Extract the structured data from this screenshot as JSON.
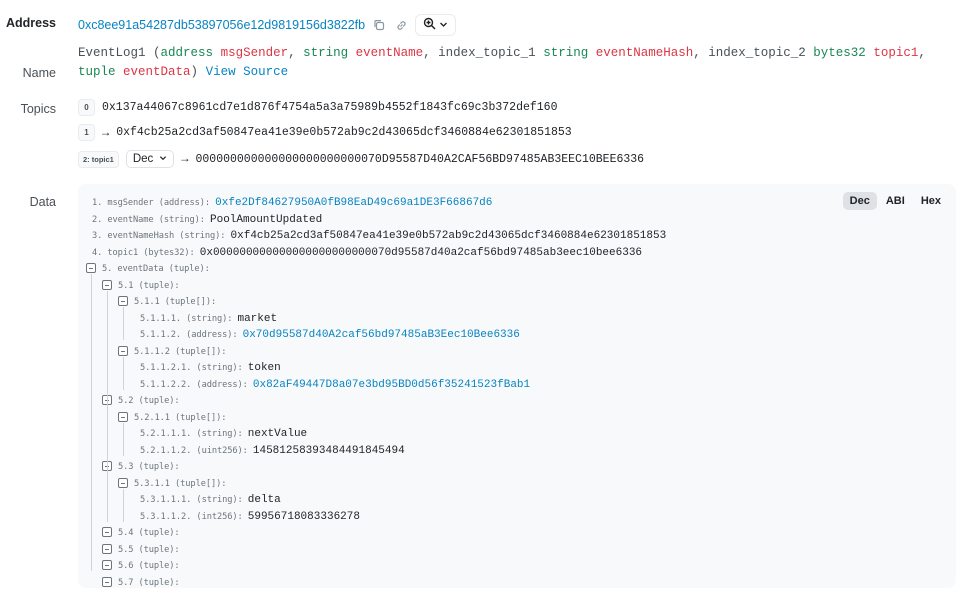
{
  "labels": {
    "address": "Address",
    "name": "Name",
    "topics": "Topics",
    "data": "Data"
  },
  "address": {
    "value": "0xc8ee91a54287db53897056e12d9819156d3822fb",
    "copy_icon": "copy-icon",
    "link_icon": "link-icon",
    "zoom_icon": "magnifier-plus-icon",
    "chevron_icon": "chevron-down-icon"
  },
  "name": {
    "fn": "EventLog1",
    "open": " (",
    "close": ")",
    "sep": ", ",
    "params": [
      {
        "prefix": "",
        "type": "address",
        "name": "msgSender"
      },
      {
        "prefix": "",
        "type": "string",
        "name": "eventName"
      },
      {
        "prefix": "index_topic_1 ",
        "type": "string",
        "name": "eventNameHash"
      },
      {
        "prefix": "index_topic_2 ",
        "type": "bytes32",
        "name": "topic1"
      },
      {
        "prefix": "",
        "type": "tuple",
        "name": "eventData"
      }
    ],
    "view_source": "View Source"
  },
  "topics": [
    {
      "index": "0",
      "arrow": "",
      "value": "0x137a44067c8961cd7e1d876f4754a5a3a75989b4552f1843fc69c3b372def160"
    },
    {
      "index": "1",
      "arrow": "→",
      "value": "0xf4cb25a2cd3af50847ea41e39e0b572ab9c2d43065dcf3460884e62301851853"
    },
    {
      "index": "2: topic1",
      "select": "Dec",
      "arrow": "→",
      "value": "000000000000000000000000070D95587D40A2CAF56BD97485AB3EEC10BEE6336"
    }
  ],
  "format_buttons": [
    "Dec",
    "ABI",
    "Hex"
  ],
  "active_format": "Dec",
  "data_lines": [
    {
      "label": "1. msgSender (address): ",
      "value": "0xfe2Df84627950A0fB98EaD49c69a1DE3F66867d6",
      "link": true
    },
    {
      "label": "2. eventName (string): ",
      "value": "PoolAmountUpdated"
    },
    {
      "label": "3. eventNameHash (string): ",
      "value": "0xf4cb25a2cd3af50847ea41e39e0b572ab9c2d43065dcf3460884e62301851853"
    },
    {
      "label": "4. topic1 (bytes32): ",
      "value": "0x000000000000000000000000070d95587d40a2caf56bd97485ab3eec10bee6336"
    },
    {
      "label": "5. eventData (tuple):",
      "value": "",
      "toggle": true
    },
    {
      "label": "5.1 (tuple):",
      "value": "",
      "toggle": true
    },
    {
      "label": "5.1.1 (tuple[]):",
      "value": "",
      "toggle": true
    },
    {
      "label": "5.1.1.1. (string): ",
      "value": "market"
    },
    {
      "label": "5.1.1.2. (address): ",
      "value": "0x70d95587d40A2caf56bd97485aB3Eec10Bee6336",
      "link": true
    },
    {
      "label": "5.1.1.2 (tuple[]):",
      "value": "",
      "toggle": true
    },
    {
      "label": "5.1.1.2.1. (string): ",
      "value": "token"
    },
    {
      "label": "5.1.1.2.2. (address): ",
      "value": "0x82aF49447D8a07e3bd95BD0d56f35241523fBab1",
      "link": true
    },
    {
      "label": "5.2 (tuple):",
      "value": "",
      "toggle": true
    },
    {
      "label": "5.2.1.1 (tuple[]):",
      "value": "",
      "toggle": true
    },
    {
      "label": "5.2.1.1.1. (string): ",
      "value": "nextValue"
    },
    {
      "label": "5.2.1.1.2. (uint256): ",
      "value": "14581258393484491845494"
    },
    {
      "label": "5.3 (tuple):",
      "value": "",
      "toggle": true
    },
    {
      "label": "5.3.1.1 (tuple[]):",
      "value": "",
      "toggle": true
    },
    {
      "label": "5.3.1.1.1. (string): ",
      "value": "delta"
    },
    {
      "label": "5.3.1.1.2. (int256): ",
      "value": "59956718083336278"
    },
    {
      "label": "5.4 (tuple):",
      "value": "",
      "toggle": true
    },
    {
      "label": "5.5 (tuple):",
      "value": "",
      "toggle": true
    },
    {
      "label": "5.6 (tuple):",
      "value": "",
      "toggle": true
    },
    {
      "label": "5.7 (tuple):",
      "value": "",
      "toggle": true
    }
  ]
}
